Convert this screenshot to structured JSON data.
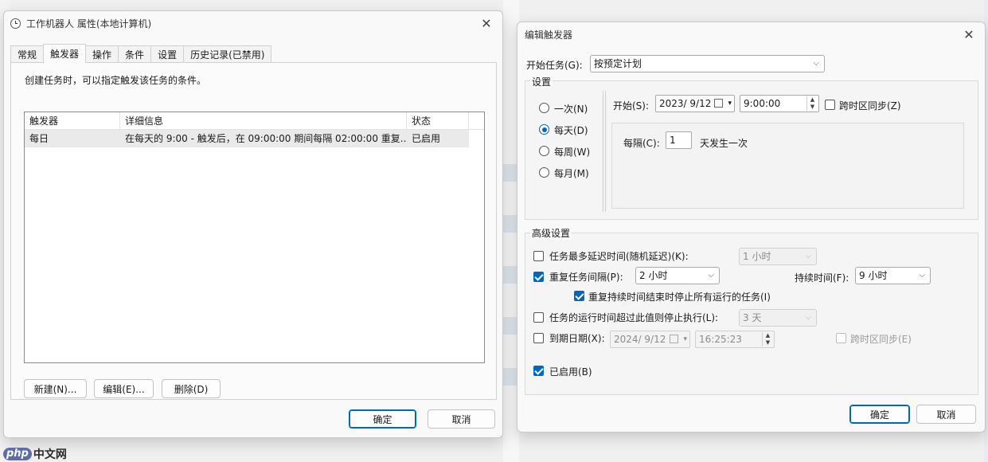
{
  "props_window": {
    "title": "工作机器人 属性(本地计算机)",
    "tabs": [
      "常规",
      "触发器",
      "操作",
      "条件",
      "设置",
      "历史记录(已禁用)"
    ],
    "active_tab": "触发器",
    "hint": "创建任务时，可以指定触发该任务的条件。",
    "columns": [
      "触发器",
      "详细信息",
      "状态"
    ],
    "rows": [
      {
        "trigger": "每日",
        "details": "在每天的 9:00 - 触发后，在 09:00:00 期间每隔 02:00:00 重复...",
        "status": "已启用"
      }
    ],
    "new_button": "新建(N)...",
    "edit_button": "编辑(E)...",
    "delete_button": "删除(D)",
    "ok_button": "确定",
    "cancel_button": "取消"
  },
  "edit_trigger": {
    "title": "编辑触发器",
    "begin_task_label": "开始任务(G):",
    "begin_task_value": "按预定计划",
    "settings_group": "设置",
    "radios": [
      "一次(N)",
      "每天(D)",
      "每周(W)",
      "每月(M)"
    ],
    "selected_radio": "每天(D)",
    "start_label": "开始(S):",
    "start_date": "2023/  9/12",
    "start_time": "9:00:00",
    "sync_timezone": "跨时区同步(Z)",
    "recur_label": "每隔(C):",
    "recur_value": "1",
    "recur_suffix": "天发生一次",
    "advanced_group": "高级设置",
    "delay_label": "任务最多延迟时间(随机延迟)(K):",
    "delay_value": "1 小时",
    "repeat_label": "重复任务间隔(P):",
    "repeat_value": "2 小时",
    "duration_label": "持续时间(F):",
    "duration_value": "9 小时",
    "stop_all_label": "重复持续时间结束时停止所有运行的任务(I)",
    "stop_if_longer_label": "任务的运行时间超过此值则停止执行(L):",
    "stop_if_longer_value": "3 天",
    "expire_label": "到期日期(X):",
    "expire_date": "2024/  9/12",
    "expire_time": "16:25:23",
    "expire_sync": "跨时区同步(E)",
    "enabled_label": "已启用(B)",
    "ok_button": "确定",
    "cancel_button": "取消"
  },
  "watermark": "中文网",
  "watermark_logo": "php"
}
